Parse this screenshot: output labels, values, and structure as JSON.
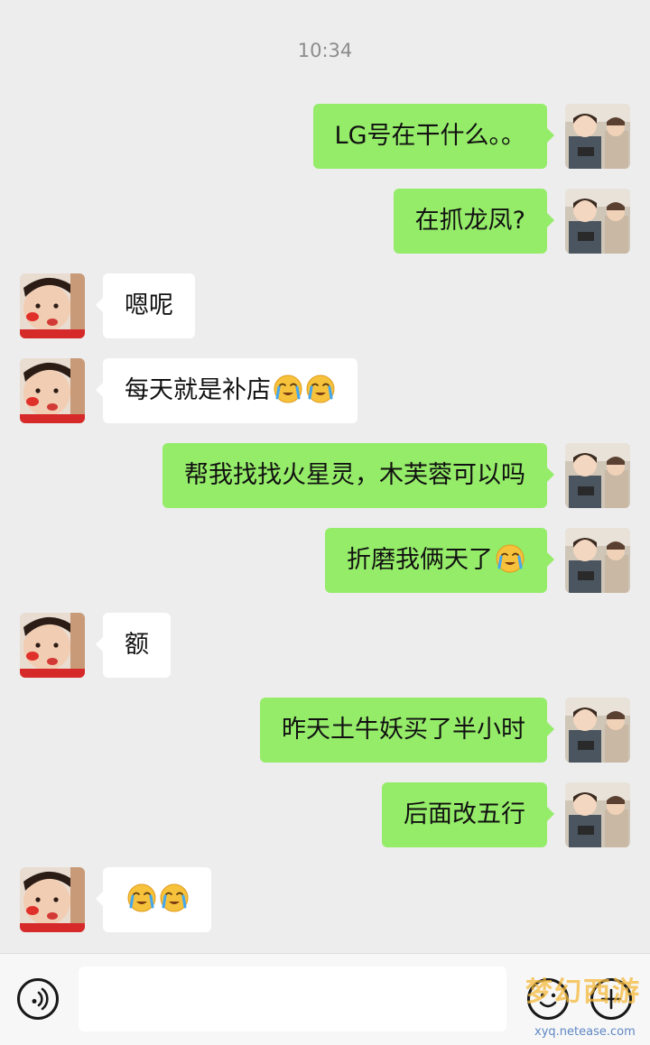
{
  "chat": {
    "timestamp": "10:34",
    "messages": [
      {
        "side": "self",
        "text": "LG号在干什么。。",
        "emojis": 0
      },
      {
        "side": "self",
        "text": "在抓龙凤?",
        "emojis": 0
      },
      {
        "side": "other",
        "text": "嗯呢",
        "emojis": 0
      },
      {
        "side": "other",
        "text": "每天就是补店",
        "emojis": 2
      },
      {
        "side": "self",
        "text": "帮我找找火星灵，木芙蓉可以吗",
        "emojis": 0
      },
      {
        "side": "self",
        "text": "折磨我俩天了",
        "emojis": 1
      },
      {
        "side": "other",
        "text": "额",
        "emojis": 0
      },
      {
        "side": "self",
        "text": "昨天土牛妖买了半小时",
        "emojis": 0
      },
      {
        "side": "self",
        "text": "后面改五行",
        "emojis": 0
      },
      {
        "side": "other",
        "text": "",
        "emojis": 2
      }
    ]
  },
  "colors": {
    "self_bubble": "#95ec69",
    "other_bubble": "#ffffff",
    "background": "#ededed"
  },
  "icons": {
    "emoji": "loudly-crying-face",
    "voice": "voice-wave-icon",
    "emoji_button": "smiley-icon",
    "more": "plus-icon"
  },
  "input": {
    "value": "",
    "placeholder": ""
  },
  "watermark": {
    "title": "梦幻西游",
    "url": "xyq.netease.com"
  }
}
